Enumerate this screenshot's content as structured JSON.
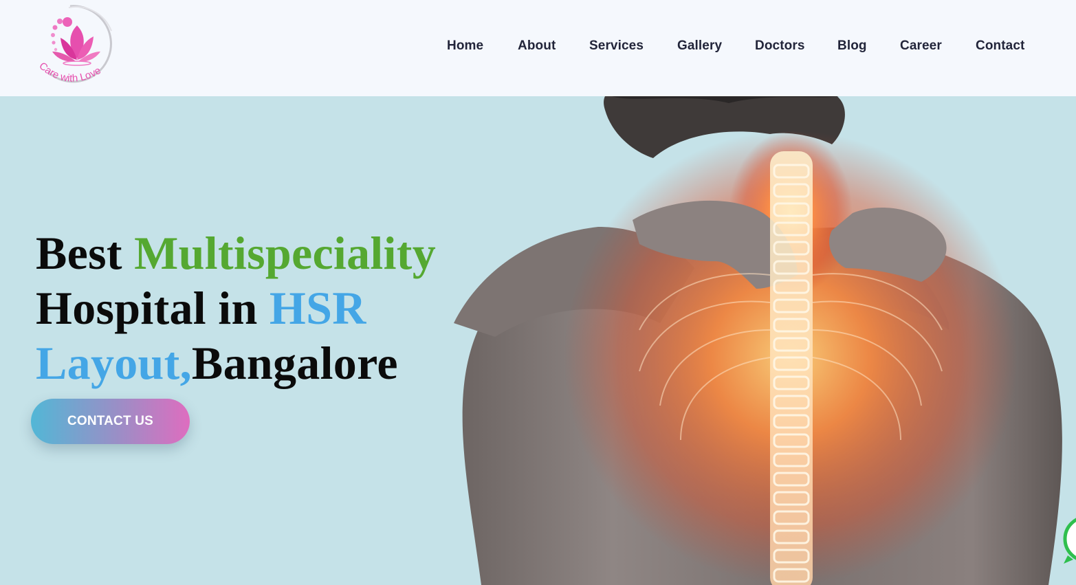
{
  "header": {
    "logo": {
      "icon": "lotus-logo-icon",
      "tagline": "Care with Love",
      "brand_color": "#e64fae"
    },
    "nav": [
      {
        "label": "Home"
      },
      {
        "label": "About"
      },
      {
        "label": "Services"
      },
      {
        "label": "Gallery"
      },
      {
        "label": "Doctors"
      },
      {
        "label": "Blog"
      },
      {
        "label": "Career"
      },
      {
        "label": "Contact"
      }
    ]
  },
  "hero": {
    "headline": {
      "part1": "Best ",
      "part2": "Multispeciality",
      "part3": "Hospital in ",
      "part4": "HSR",
      "part5": "Layout,",
      "part6": "Bangalore"
    },
    "cta_label": "CONTACT US",
    "image": "man-holding-neck-highlighted-spine-photo",
    "colors": {
      "background": "#c5e2e8",
      "green": "#55a831",
      "blue": "#44a6e6"
    }
  },
  "floating": {
    "icon": "whatsapp-icon"
  }
}
